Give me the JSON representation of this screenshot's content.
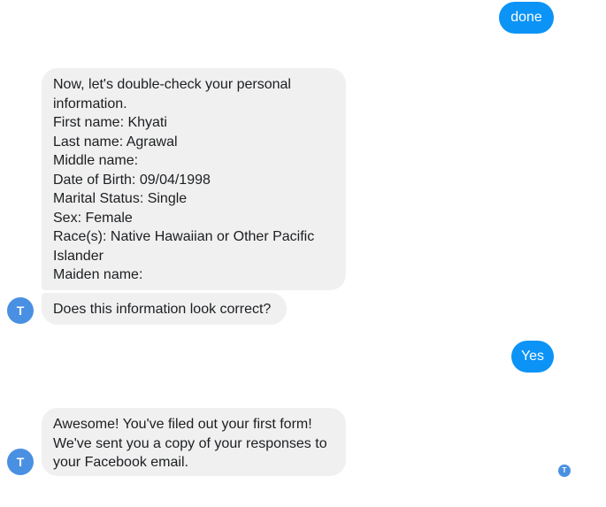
{
  "messages": {
    "done": "done",
    "confirm_info": "Now, let's double-check your personal\ninformation.\nFirst name: Khyati\nLast name: Agrawal\nMiddle name:\nDate of Birth: 09/04/1998\nMarital Status: Single\nSex: Female\nRace(s): Native Hawaiian or Other Pacific\nIslander\nMaiden name:",
    "question": "Does this information look correct?",
    "yes": "Yes",
    "final": "Awesome! You've filed out your first form!\nWe've sent you a copy of your responses to\nyour Facebook email."
  },
  "bot": {
    "avatar_letter": "T"
  },
  "colors": {
    "sent_bubble": "#0b93f6",
    "received_bubble": "#f0f0f0",
    "avatar": "#4a90e2"
  }
}
